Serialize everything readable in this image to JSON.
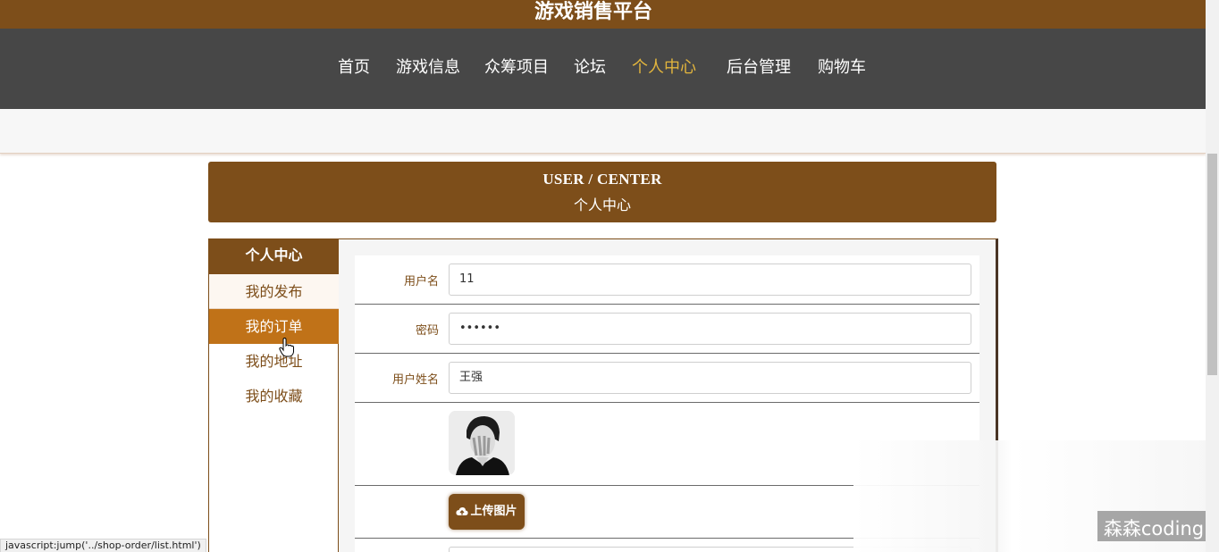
{
  "header": {
    "title": "游戏销售平台"
  },
  "nav": {
    "items": [
      {
        "label": "首页",
        "active": false
      },
      {
        "label": "游戏信息",
        "active": false
      },
      {
        "label": "众筹项目",
        "active": false
      },
      {
        "label": "论坛",
        "active": false
      },
      {
        "label": "个人中心",
        "active": true
      },
      {
        "label": "后台管理",
        "active": false
      },
      {
        "label": "购物车",
        "active": false
      }
    ]
  },
  "center_header": {
    "en": "USER / CENTER",
    "cn": "个人中心"
  },
  "sidebar": {
    "title": "个人中心",
    "items": [
      {
        "label": "我的发布",
        "state": "hover"
      },
      {
        "label": "我的订单",
        "state": "selected"
      },
      {
        "label": "我的地址",
        "state": "normal"
      },
      {
        "label": "我的收藏",
        "state": "normal"
      }
    ]
  },
  "form": {
    "username": {
      "label": "用户名",
      "value": "11"
    },
    "password": {
      "label": "密码",
      "value": "••••••"
    },
    "realname": {
      "label": "用户姓名",
      "value": "王强"
    },
    "avatar": {
      "alt_icon": "avatar-photo"
    },
    "upload_label": "上传图片"
  },
  "status_bar": {
    "text": "javascript:jump('../shop-order/list.html')"
  },
  "watermark": {
    "text": "森森coding"
  },
  "colors": {
    "brand": "#7d4e1a",
    "nav_bg": "#474747",
    "nav_active": "#e2b53d",
    "selected": "#c07218"
  }
}
